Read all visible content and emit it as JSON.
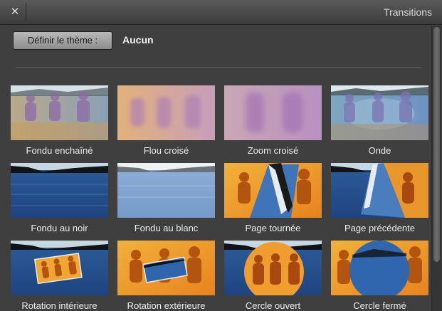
{
  "window": {
    "title": "Transitions",
    "close_label": "✕"
  },
  "theme": {
    "button_label": "Définir le thème :",
    "value": "Aucun"
  },
  "transitions": [
    {
      "label": "Fondu enchaîné"
    },
    {
      "label": "Flou croisé"
    },
    {
      "label": "Zoom croisé"
    },
    {
      "label": "Onde"
    },
    {
      "label": "Fondu au noir"
    },
    {
      "label": "Fondu au blanc"
    },
    {
      "label": "Page tournée"
    },
    {
      "label": "Page précédente"
    },
    {
      "label": "Rotation intérieure"
    },
    {
      "label": "Rotation extérieure"
    },
    {
      "label": "Cercle ouvert"
    },
    {
      "label": "Cercle fermé"
    }
  ]
}
